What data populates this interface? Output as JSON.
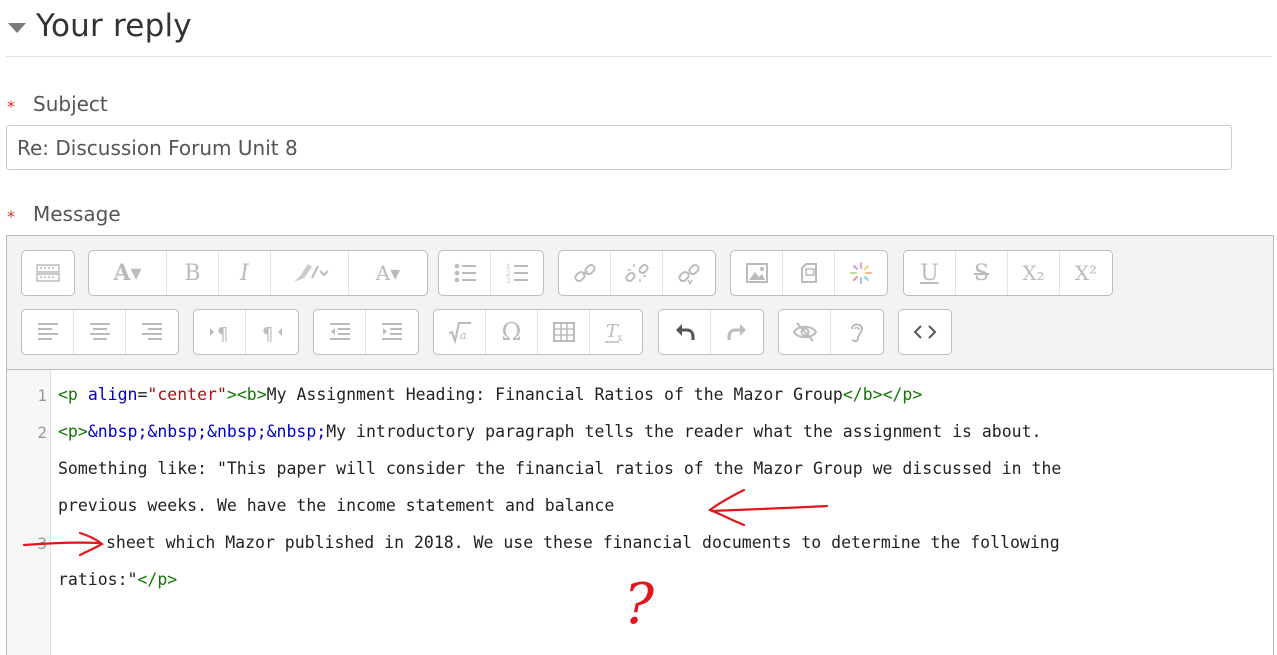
{
  "section": {
    "title": "Your reply"
  },
  "subject": {
    "required_mark": "*",
    "label": "Subject",
    "value": "Re: Discussion Forum Unit 8"
  },
  "message": {
    "required_mark": "*",
    "label": "Message"
  },
  "toolbar": {
    "rows": [
      [
        {
          "name": "show-more-buttons",
          "icon": "toolbar-toggle-icon"
        },
        {
          "name": "font-size",
          "icon": "font-size-icon",
          "glyph": "A▾"
        },
        {
          "name": "bold",
          "icon": "bold-icon",
          "glyph": "B"
        },
        {
          "name": "italic",
          "icon": "italic-icon",
          "glyph": "I"
        },
        {
          "name": "highlight",
          "icon": "highlighter-icon"
        },
        {
          "name": "font-color",
          "icon": "font-color-icon",
          "glyph": "A▾"
        },
        {
          "name": "bulleted-list",
          "icon": "unordered-list-icon"
        },
        {
          "name": "numbered-list",
          "icon": "ordered-list-icon"
        },
        {
          "name": "link",
          "icon": "link-icon"
        },
        {
          "name": "unlink",
          "icon": "unlink-icon"
        },
        {
          "name": "auto-link",
          "icon": "auto-link-icon"
        },
        {
          "name": "insert-image",
          "icon": "image-icon"
        },
        {
          "name": "media",
          "icon": "media-icon"
        },
        {
          "name": "h5p",
          "icon": "h5p-icon"
        },
        {
          "name": "underline",
          "icon": "underline-icon",
          "glyph": "U"
        },
        {
          "name": "strikethrough",
          "icon": "strikethrough-icon",
          "glyph": "S"
        },
        {
          "name": "subscript",
          "icon": "subscript-icon",
          "glyph": "X₂"
        },
        {
          "name": "superscript",
          "icon": "superscript-icon",
          "glyph": "X²"
        }
      ],
      [
        {
          "name": "align-left",
          "icon": "align-left-icon"
        },
        {
          "name": "align-center",
          "icon": "align-center-icon"
        },
        {
          "name": "align-right",
          "icon": "align-right-icon"
        },
        {
          "name": "ltr",
          "icon": "ltr-icon"
        },
        {
          "name": "rtl",
          "icon": "rtl-icon"
        },
        {
          "name": "outdent",
          "icon": "outdent-icon"
        },
        {
          "name": "indent",
          "icon": "indent-icon"
        },
        {
          "name": "equation",
          "icon": "equation-icon"
        },
        {
          "name": "special-chars",
          "icon": "omega-icon",
          "glyph": "Ω"
        },
        {
          "name": "table",
          "icon": "table-icon"
        },
        {
          "name": "clear-formatting",
          "icon": "clear-formatting-icon"
        },
        {
          "name": "undo",
          "icon": "undo-icon"
        },
        {
          "name": "redo",
          "icon": "redo-icon"
        },
        {
          "name": "screenreader-helper",
          "icon": "eye-slash-icon"
        },
        {
          "name": "accessibility-checker",
          "icon": "ear-icon"
        },
        {
          "name": "html-source",
          "icon": "code-icon"
        }
      ]
    ]
  },
  "code": {
    "line_numbers": [
      "1",
      "2",
      "3"
    ],
    "line1": {
      "t1": "<p ",
      "t2": "align",
      "t3": "=",
      "t4": "\"center\"",
      "t5": "><b>",
      "t6": "My Assignment Heading: Financial Ratios of the Mazor Group",
      "t7": "</b></p>"
    },
    "line2": {
      "t1": "<p>",
      "t2": "&nbsp;&nbsp;&nbsp;&nbsp;",
      "t3": "My introductory paragraph tells the reader what the assignment is about.",
      "wrap1": "Something like: \"This paper will consider the financial ratios of the Mazor Group we discussed in the",
      "wrap2": "previous weeks. We have the income statement and balance"
    },
    "line3": {
      "text": "sheet which Mazor published in 2018. We use these financial documents to determine the following",
      "wrap1": "ratios:\"",
      "wrap1_tag": "</p>"
    }
  },
  "annotations": {
    "question_mark": "?"
  },
  "colors": {
    "required": "#e1301e",
    "tag": "#117700",
    "attribute": "#0000cc",
    "string": "#aa1111",
    "annotation": "#e0161b"
  }
}
